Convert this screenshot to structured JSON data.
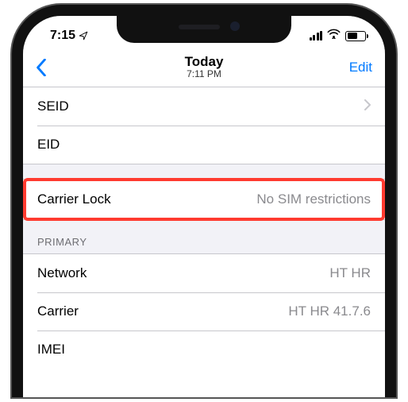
{
  "status": {
    "time": "7:15",
    "battery_pct": 52
  },
  "nav": {
    "title": "Today",
    "subtitle": "7:11 PM",
    "edit_label": "Edit"
  },
  "rows": {
    "seid": {
      "label": "SEID",
      "value": ""
    },
    "eid": {
      "label": "EID",
      "value": ""
    },
    "carrier_lock": {
      "label": "Carrier Lock",
      "value": "No SIM restrictions"
    }
  },
  "section_primary": {
    "header": "PRIMARY",
    "network": {
      "label": "Network",
      "value": "HT HR"
    },
    "carrier": {
      "label": "Carrier",
      "value": "HT HR 41.7.6"
    },
    "imei": {
      "label": "IMEI",
      "value": ""
    }
  },
  "colors": {
    "accent": "#007aff",
    "highlight": "#ff3b30",
    "separator": "#c7c7cc",
    "group_bg": "#f2f2f7",
    "secondary_text": "#8a8a8e"
  }
}
